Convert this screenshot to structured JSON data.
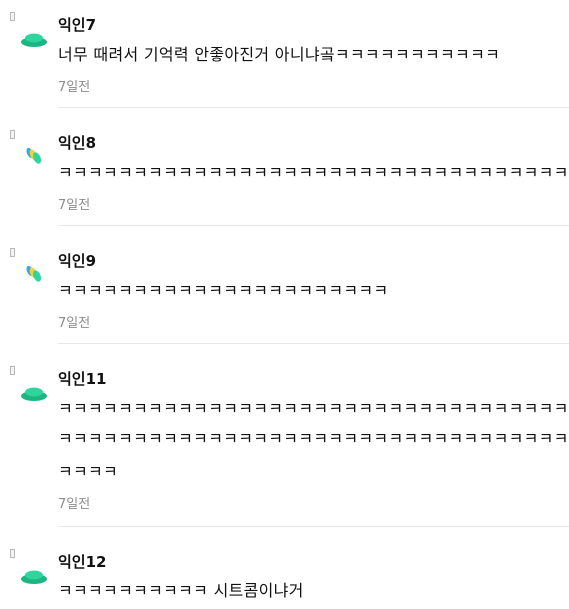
{
  "comments": [
    {
      "author": "익인7",
      "avatar_icon": "green-stack-icon",
      "lines": [
        "너무 때려서 기억력 안좋아진거 아니냐곸ㅋㅋㅋㅋㅋㅋㅋㅋㅋㅋㅋ"
      ],
      "time": "7일전"
    },
    {
      "author": "익인8",
      "avatar_icon": "multicolor-pills-icon",
      "lines": [
        "ㅋㅋㅋㅋㅋㅋㅋㅋㅋㅋㅋㅋㅋㅋㅋㅋㅋㅋㅋㅋㅋㅋㅋㅋㅋㅋㅋㅋㅋㅋㅋㅋㅋㅋㅋㅋㅋ"
      ],
      "time": "7일전"
    },
    {
      "author": "익인9",
      "avatar_icon": "multicolor-pills-icon",
      "lines": [
        "ㅋㅋㅋㅋㅋㅋㅋㅋㅋㅋㅋㅋㅋㅋㅋㅋㅋㅋㅋㅋㅋㅋ"
      ],
      "time": "7일전"
    },
    {
      "author": "익인11",
      "avatar_icon": "green-stack-icon",
      "lines": [
        "ㅋㅋㅋㅋㅋㅋㅋㅋㅋㅋㅋㅋㅋㅋㅋㅋㅋㅋㅋㅋㅋㅋㅋㅋㅋㅋㅋㅋㅋㅋㅋㅋㅋㅋㅋㅋㅋ",
        "ㅋㅋㅋㅋㅋㅋㅋㅋㅋㅋㅋㅋㅋㅋㅋㅋㅋㅋㅋㅋㅋㅋㅋㅋㅋㅋㅋㅋㅋㅋㅋㅋㅋㅋㅋㅋㅋ",
        "ㅋㅋㅋㅋ"
      ],
      "time": "7일전"
    },
    {
      "author": "익인12",
      "avatar_icon": "green-stack-icon",
      "lines": [
        "ㅋㅋㅋㅋㅋㅋㅋㅋㅋㅋ 시트콤이냐거"
      ],
      "time": ""
    }
  ],
  "colors": {
    "avatar_green_dark": "#1db584",
    "avatar_green_light": "#2fd59b",
    "avatar_blue": "#3aa9e0",
    "avatar_yellow": "#f2d43a",
    "time_gray": "#8c8c8c",
    "divider": "#e8e8e8"
  }
}
